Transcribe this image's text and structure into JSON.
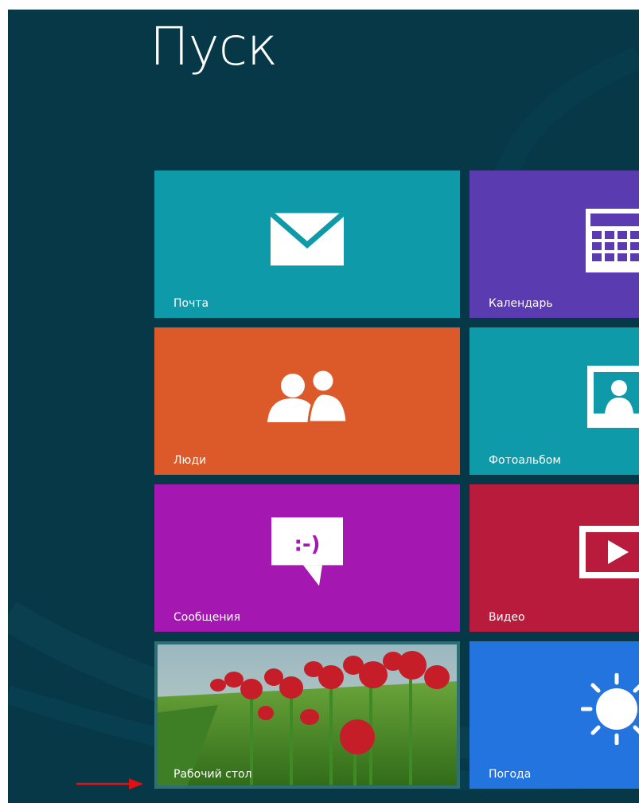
{
  "start_screen": {
    "title": "Пуск"
  },
  "tiles": [
    {
      "id": "mail",
      "label": "Почта",
      "color": "#0e9aa8",
      "icon": "envelope-icon"
    },
    {
      "id": "calendar",
      "label": "Календарь",
      "color": "#5a3bb0",
      "icon": "calendar-icon"
    },
    {
      "id": "people",
      "label": "Люди",
      "color": "#dc5a2a",
      "icon": "people-icon"
    },
    {
      "id": "photos",
      "label": "Фотоальбом",
      "color": "#0e9aa8",
      "icon": "photo-icon"
    },
    {
      "id": "messaging",
      "label": "Сообщения",
      "color": "#a417b0",
      "icon": "chat-bubble-icon",
      "icon_text": ":-)"
    },
    {
      "id": "video",
      "label": "Видео",
      "color": "#b81b3c",
      "icon": "play-icon"
    },
    {
      "id": "desktop",
      "label": "Рабочий стол",
      "color": "#2e6f74",
      "icon": "tulips-wallpaper"
    },
    {
      "id": "weather",
      "label": "Погода",
      "color": "#2474e0",
      "icon": "sun-icon"
    }
  ],
  "colors": {
    "background": "#063848",
    "arrow": "#e01010"
  }
}
